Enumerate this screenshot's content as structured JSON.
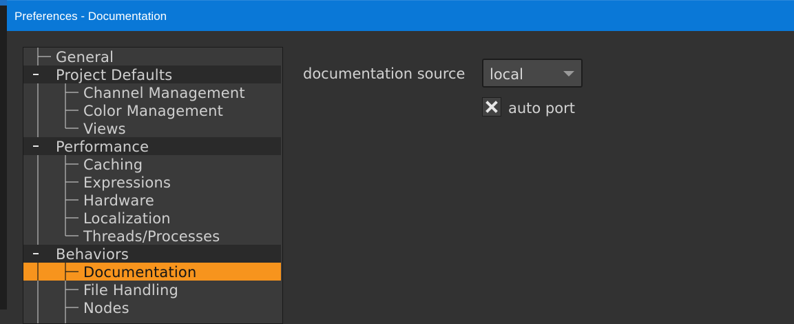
{
  "window": {
    "title": "Preferences - Documentation"
  },
  "tree": {
    "items": [
      {
        "label": "General",
        "level": 0,
        "group": false
      },
      {
        "label": "Project Defaults",
        "level": 0,
        "group": true
      },
      {
        "label": "Channel Management",
        "level": 1,
        "group": false
      },
      {
        "label": "Color Management",
        "level": 1,
        "group": false
      },
      {
        "label": "Views",
        "level": 1,
        "group": false
      },
      {
        "label": "Performance",
        "level": 0,
        "group": true
      },
      {
        "label": "Caching",
        "level": 1,
        "group": false
      },
      {
        "label": "Expressions",
        "level": 1,
        "group": false
      },
      {
        "label": "Hardware",
        "level": 1,
        "group": false
      },
      {
        "label": "Localization",
        "level": 1,
        "group": false
      },
      {
        "label": "Threads/Processes",
        "level": 1,
        "group": false
      },
      {
        "label": "Behaviors",
        "level": 0,
        "group": true
      },
      {
        "label": "Documentation",
        "level": 1,
        "group": false,
        "selected": true
      },
      {
        "label": "File Handling",
        "level": 1,
        "group": false
      },
      {
        "label": "Nodes",
        "level": 1,
        "group": false
      }
    ]
  },
  "settings": {
    "documentation_source": {
      "label": "documentation source",
      "value": "local"
    },
    "auto_port": {
      "label": "auto port",
      "checked": true
    }
  },
  "colors": {
    "titlebar": "#0a78d7",
    "selection": "#f7941d",
    "background": "#323232"
  }
}
